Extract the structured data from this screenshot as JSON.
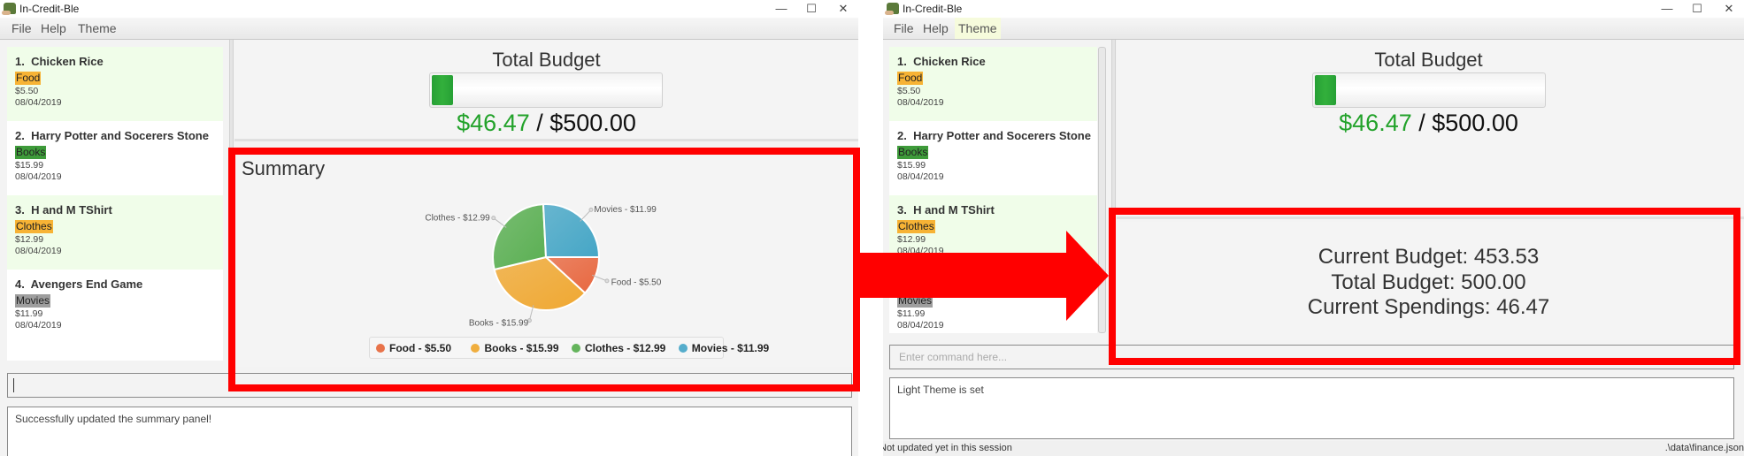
{
  "app_title": "In-Credit-Ble",
  "menu": [
    "File",
    "Help",
    "Theme"
  ],
  "expenses": [
    {
      "index": "1.",
      "name": "Chicken Rice",
      "tag": "Food",
      "price": "$5.50",
      "date": "08/04/2019"
    },
    {
      "index": "2.",
      "name": "Harry Potter and Socerers Stone",
      "tag": "Books",
      "price": "$15.99",
      "date": "08/04/2019"
    },
    {
      "index": "3.",
      "name": "H and M TShirt",
      "tag": "Clothes",
      "price": "$12.99",
      "date": "08/04/2019"
    },
    {
      "index": "4.",
      "name": "Avengers End Game",
      "tag": "Movies",
      "price": "$11.99",
      "date": "08/04/2019"
    }
  ],
  "tag_colors": {
    "Food": "#f7b335",
    "Books": "#3e9b3a",
    "Clothes": "#f7b335",
    "Movies": "#9e9e9e"
  },
  "budget": {
    "title": "Total Budget",
    "spent": "$46.47",
    "separator": " / ",
    "total": "$500.00",
    "progress_fraction": 0.093
  },
  "left_window": {
    "summary_title": "Summary",
    "command_value": "",
    "result_text": "Successfully updated the summary panel!"
  },
  "right_window": {
    "active_menu": "Theme",
    "summary_lines": [
      "Current Budget: 453.53",
      "Total Budget: 500.00",
      "Current Spendings: 46.47"
    ],
    "command_placeholder": "Enter command here...",
    "result_text": "Light Theme is set",
    "status_left": "Not updated yet in this session",
    "status_right": ".\\data\\finance.json"
  },
  "chart_data": {
    "type": "pie",
    "categories": [
      "Food",
      "Books",
      "Clothes",
      "Movies"
    ],
    "values": [
      5.5,
      15.99,
      12.99,
      11.99
    ],
    "slice_labels": [
      "Food - $5.50",
      "Books - $15.99",
      "Clothes - $12.99",
      "Movies - $11.99"
    ],
    "legend": [
      "Food - $5.50",
      "Books - $15.99",
      "Clothes - $12.99",
      "Movies - $11.99"
    ],
    "legend_placement": "bottom",
    "colors": [
      "#e8673f",
      "#f0a832",
      "#5aaf52",
      "#45a6c6"
    ]
  },
  "annotation_color": "#ff0000"
}
